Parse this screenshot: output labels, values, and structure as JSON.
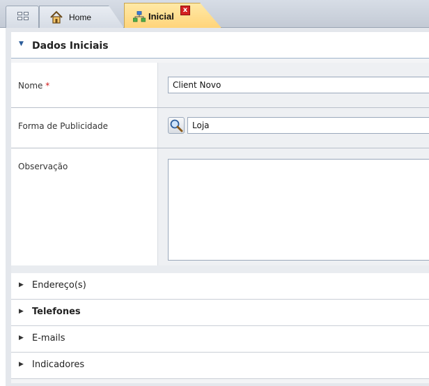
{
  "tabs": [
    {
      "label": "Home",
      "icon": "home-icon"
    },
    {
      "label": "Inicial",
      "icon": "network-icon",
      "active": true,
      "close_label": "x"
    }
  ],
  "form": {
    "section_title": "Dados Iniciais",
    "fields": {
      "nome": {
        "label": "Nome",
        "required_marker": "*",
        "value": "Client Novo"
      },
      "publicidade": {
        "label": "Forma de Publicidade",
        "value": "Loja"
      },
      "observacao": {
        "label": "Observação",
        "value": ""
      }
    }
  },
  "sections": [
    {
      "title": "Endereço(s)"
    },
    {
      "title": "Telefones"
    },
    {
      "title": "E-mails"
    },
    {
      "title": "Indicadores"
    }
  ],
  "colors": {
    "active_tab": "#ffd47a",
    "required": "#d01818",
    "close": "#d42020"
  }
}
